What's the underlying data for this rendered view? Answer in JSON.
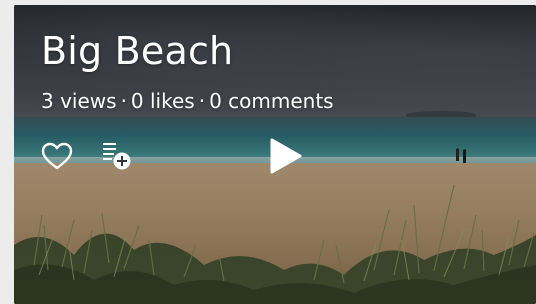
{
  "video": {
    "title": "Big Beach",
    "views": "3 views",
    "likes": "0 likes",
    "comments": "0 comments",
    "separator": "·"
  },
  "actions": {
    "like_icon": "heart-outline-icon",
    "add_to_playlist_icon": "playlist-add-icon",
    "play_icon": "play-icon"
  },
  "colors": {
    "overlay_text": "#ffffff",
    "page_background": "#ececec"
  }
}
